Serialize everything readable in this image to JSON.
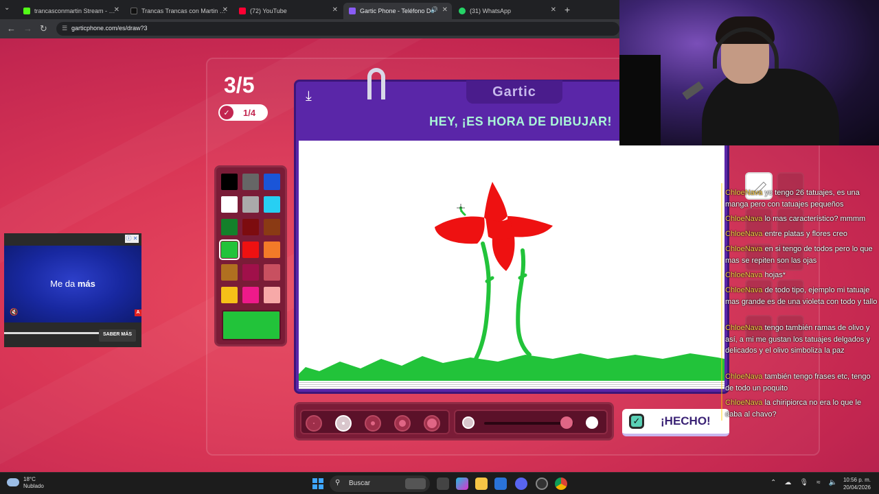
{
  "browser": {
    "tabs": [
      {
        "label": "trancasconmartin Stream - Wat",
        "favicon_color": "#53fc18"
      },
      {
        "label": "Trancas Trancas con Martin (@t",
        "favicon_color": "#111111"
      },
      {
        "label": "(72) YouTube",
        "favicon_color": "#ff0033"
      },
      {
        "label": "Gartic Phone - Teléfono De",
        "favicon_color": "#8a5cf6",
        "active": true
      },
      {
        "label": "(31) WhatsApp",
        "favicon_color": "#25d366"
      }
    ],
    "new_tab": "+",
    "url": "garticphone.com/es/draw?3"
  },
  "game": {
    "round": "3/5",
    "progress": "1/4",
    "logo": "Gartic",
    "heading": "HEY, ¡ES HORA DE DIBUJAR!",
    "done_label": "¡HECHO!",
    "selected_color": "#22c33a",
    "palette": [
      [
        "#000000",
        "#666666",
        "#1a55d8"
      ],
      [
        "#ffffff",
        "#aaaaaa",
        "#27cff3"
      ],
      [
        "#14802a",
        "#7d0c0f",
        "#8a3a14"
      ],
      [
        "#22c33a",
        "#ee1111",
        "#f37a28"
      ],
      [
        "#b07020",
        "#a0104a",
        "#c85060"
      ],
      [
        "#f6c018",
        "#ee1a8a",
        "#f7a9a8"
      ]
    ],
    "selected_palette_index": [
      3,
      0
    ],
    "brush_sizes": 5,
    "selected_brush": 1,
    "opacity_level": 0.85
  },
  "chat": [
    {
      "user": "ChloeNava",
      "text": "yo tengo 26 tatuajes, es una manga pero con tatuajes pequeños"
    },
    {
      "user": "ChloeNava",
      "text": "lo mas característico? mmmm"
    },
    {
      "user": "ChloeNava",
      "text": "entre platas y flores creo"
    },
    {
      "user": "ChloeNava",
      "text": "en si tengo de todos pero lo que mas se repiten son las ojas"
    },
    {
      "user": "ChloeNava",
      "text": "hojas*"
    },
    {
      "user": "ChloeNava",
      "text": "de todo tipo, ejemplo mi tatuaje mas grande es de una violeta con todo y tallo"
    },
    {
      "user": "ChloeNava",
      "text": "tengo también ramas de olivo y así, a mi me gustan los tatuajes delgados y delicados y el olivo simboliza la paz"
    },
    {
      "user": "ChloeNava",
      "text": "también tengo frases etc, tengo de todo un poquito"
    },
    {
      "user": "ChloeNava",
      "text": "la chiripiorca no era lo que le daba al chavo?"
    }
  ],
  "ad": {
    "text_prefix": "Me da ",
    "text_bold": "más",
    "cta": "SABER MÁS",
    "badge": "A"
  },
  "taskbar": {
    "temperature": "18°C",
    "weather": "Nublado",
    "search_placeholder": "Buscar",
    "time": "10:56 p. m.",
    "date": "20/04/2026"
  }
}
